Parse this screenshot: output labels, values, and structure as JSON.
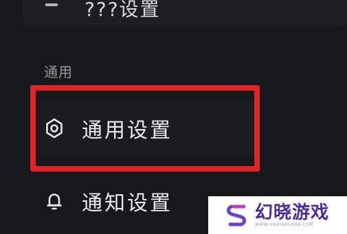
{
  "top_card": {
    "label": "???设置",
    "icon": "list-icon"
  },
  "section": {
    "label": "通用"
  },
  "menu": {
    "items": [
      {
        "label": "通用设置",
        "icon": "gear-icon",
        "selected": true
      },
      {
        "label": "通知设置",
        "icon": "bell-icon",
        "selected": false
      }
    ]
  },
  "colors": {
    "background": "#17181b",
    "highlight": "#e02424",
    "watermark_text": "#4a2ba0"
  },
  "watermark": {
    "title": "幻晓游戏",
    "subtitle": "WWW.HNXIAOLABA.COM"
  }
}
